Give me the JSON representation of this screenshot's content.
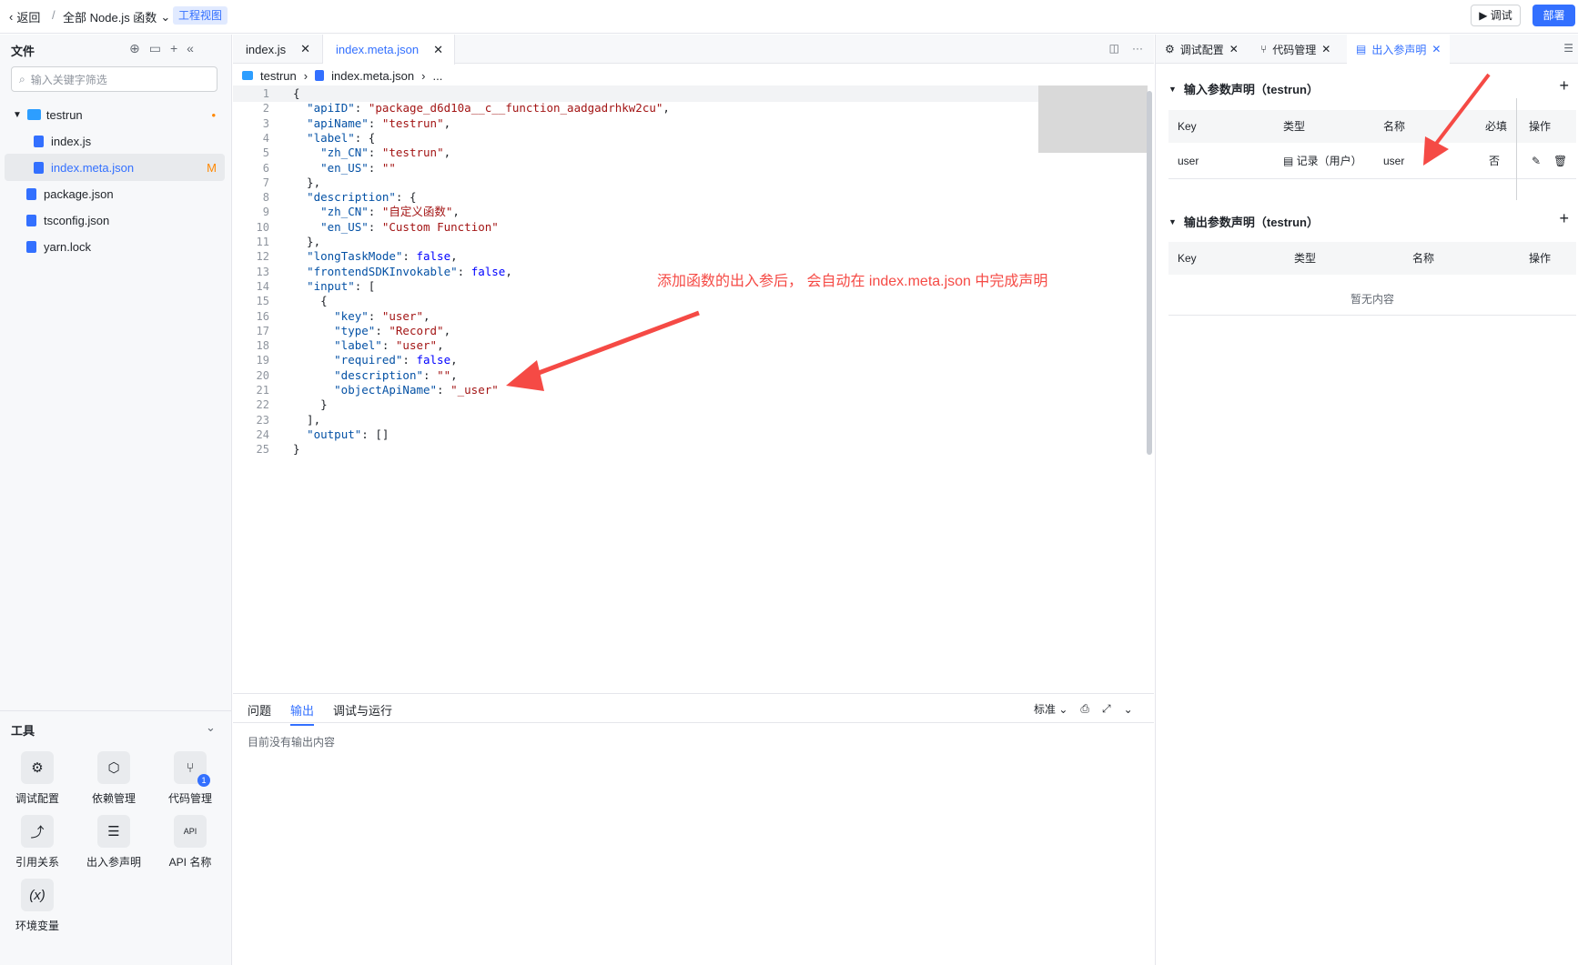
{
  "topbar": {
    "back_label": "返回",
    "scope_label": "全部 Node.js 函数",
    "view_badge": "工程视图",
    "debug_label": "调试",
    "deploy_label": "部署"
  },
  "sidebar": {
    "title": "文件",
    "search_placeholder": "输入关键字筛选",
    "folder": {
      "name": "testrun",
      "status": "•"
    },
    "files": [
      {
        "name": "index.js",
        "status": ""
      },
      {
        "name": "index.meta.json",
        "status": "M"
      },
      {
        "name": "package.json",
        "status": ""
      },
      {
        "name": "tsconfig.json",
        "status": ""
      },
      {
        "name": "yarn.lock",
        "status": ""
      }
    ],
    "tools_title": "工具",
    "tools": [
      {
        "label": "调试配置",
        "icon": "debug-config-icon"
      },
      {
        "label": "依赖管理",
        "icon": "package-icon"
      },
      {
        "label": "代码管理",
        "icon": "git-icon",
        "badge": "1"
      },
      {
        "label": "引用关系",
        "icon": "relation-icon"
      },
      {
        "label": "出入参声明",
        "icon": "params-icon"
      },
      {
        "label": "API 名称",
        "icon": "api-icon"
      },
      {
        "label": "环境变量",
        "icon": "variable-icon"
      }
    ]
  },
  "editor": {
    "tabs": [
      {
        "label": "index.js"
      },
      {
        "label": "index.meta.json"
      }
    ],
    "breadcrumb": [
      "testrun",
      "index.meta.json",
      "..."
    ],
    "code_lines": [
      "{",
      "  \"apiID\": \"package_d6d10a__c__function_aadgadrhkw2cu\",",
      "  \"apiName\": \"testrun\",",
      "  \"label\": {",
      "    \"zh_CN\": \"testrun\",",
      "    \"en_US\": \"\"",
      "  },",
      "  \"description\": {",
      "    \"zh_CN\": \"自定义函数\",",
      "    \"en_US\": \"Custom Function\"",
      "  },",
      "  \"longTaskMode\": false,",
      "  \"frontendSDKInvokable\": false,",
      "  \"input\": [",
      "    {",
      "      \"key\": \"user\",",
      "      \"type\": \"Record\",",
      "      \"label\": \"user\",",
      "      \"required\": false,",
      "      \"description\": \"\",",
      "      \"objectApiName\": \"_user\"",
      "    }",
      "  ],",
      "  \"output\": []",
      "}"
    ],
    "annotation": "添加函数的出入参后， 会自动在 index.meta.json 中完成声明"
  },
  "bottom_panel": {
    "tabs": [
      "问题",
      "输出",
      "调试与运行"
    ],
    "active_tab": "输出",
    "level_select": "标准",
    "empty_text": "目前没有输出内容"
  },
  "right_panel": {
    "tabs": [
      {
        "label": "调试配置"
      },
      {
        "label": "代码管理"
      },
      {
        "label": "出入参声明"
      }
    ],
    "input_section": {
      "title": "输入参数声明（testrun）",
      "headers": [
        "Key",
        "类型",
        "名称",
        "必填",
        "操作"
      ],
      "rows": [
        {
          "key": "user",
          "type": "记录（用户）",
          "name": "user",
          "required": "否"
        }
      ]
    },
    "output_section": {
      "title": "输出参数声明（testrun）",
      "headers": [
        "Key",
        "类型",
        "名称",
        "操作"
      ],
      "empty_text": "暂无内容"
    }
  },
  "colors": {
    "accent": "#3370ff",
    "annotation": "#f54a45"
  }
}
